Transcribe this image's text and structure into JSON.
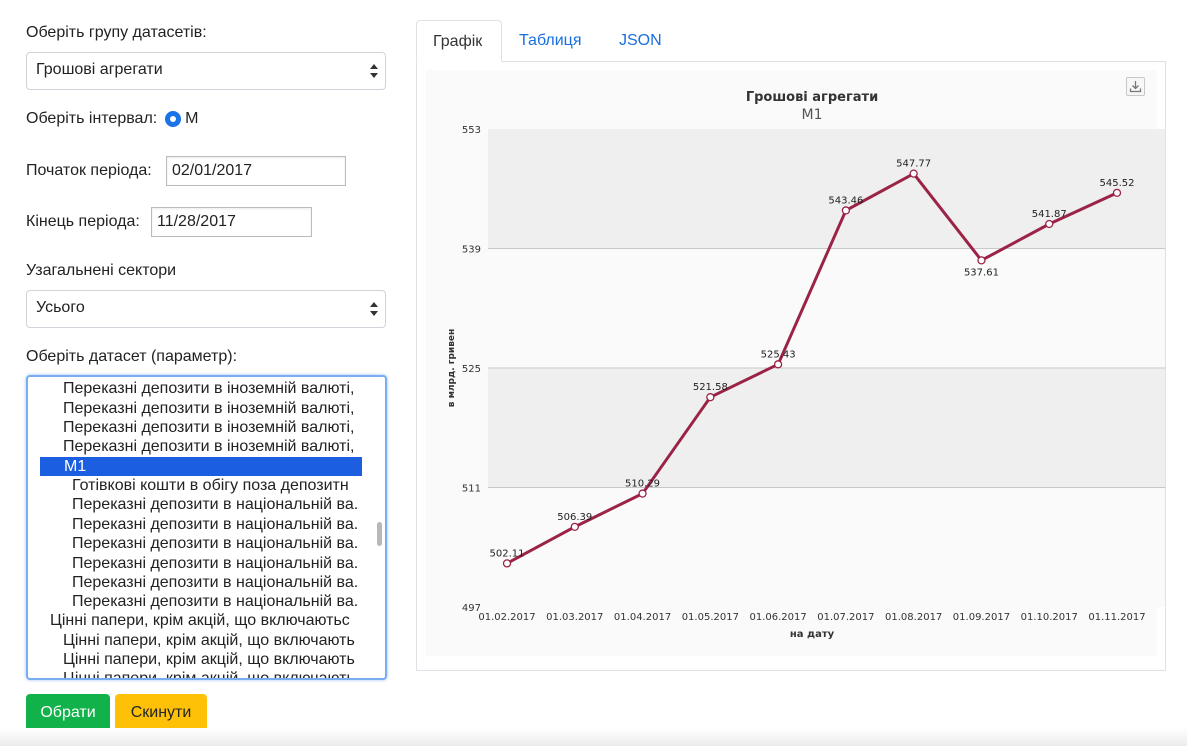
{
  "form": {
    "group_label": "Оберіть групу датасетів:",
    "group_value": "Грошові агрегати",
    "interval_label": "Оберіть інтервал:",
    "interval_option": "М",
    "start_label": "Початок періода:",
    "start_value": "02/01/2017",
    "end_label": "Кінець періода:",
    "end_value": "11/28/2017",
    "sectors_label": "Узагальнені сектори",
    "sectors_value": "Усього",
    "dataset_label": "Оберіть датасет (параметр):",
    "dataset_options": [
      "Переказні депозити в іноземній валюті,",
      "Переказні депозити в іноземній валюті,",
      "Переказні депозити в іноземній валюті,",
      "Переказні депозити в іноземній валюті,",
      "М1",
      "Готівкові кошти в обігу поза депозитн",
      "Переказні депозити в національній ва.",
      "Переказні депозити в національній ва.",
      "Переказні депозити в національній ва.",
      "Переказні депозити в національній ва.",
      "Переказні депозити в національній ва.",
      "Переказні депозити в національній ва.",
      "Цінні папери, крім акцій, що включаютьс",
      "Цінні папери, крім акцій, що включають",
      "Цінні папери, крім акцій, що включають",
      "Цінні папери, крім акцій, що включають"
    ],
    "selected_index": 4,
    "submit_label": "Обрати",
    "reset_label": "Скинути"
  },
  "tabs": [
    "Графік",
    "Таблиця",
    "JSON"
  ],
  "active_tab": 0,
  "colors": {
    "line": "#9b2346",
    "selected": "#1b5fe0",
    "tab_link": "#1a6fe0",
    "submit": "#12b24b",
    "reset": "#ffc107"
  },
  "icons": {
    "export": "download-icon",
    "select_arrow": "updown-arrows-icon"
  },
  "chart_data": {
    "type": "line",
    "title": "Грошові агрегати",
    "subtitle": "М1",
    "xlabel": "на дату",
    "ylabel": "в млрд. гривен",
    "categories": [
      "01.02.2017",
      "01.03.2017",
      "01.04.2017",
      "01.05.2017",
      "01.06.2017",
      "01.07.2017",
      "01.08.2017",
      "01.09.2017",
      "01.10.2017",
      "01.11.2017"
    ],
    "series": [
      {
        "values": [
          502.11,
          506.39,
          510.29,
          521.58,
          525.43,
          543.46,
          547.77,
          537.61,
          541.87,
          545.52
        ],
        "labels": [
          "502.11",
          "506.39",
          "510.29",
          "521.58",
          "525.43",
          "543.46",
          "547.77",
          "537.61",
          "541.87",
          "545.52"
        ]
      }
    ],
    "ylim": [
      497,
      553
    ],
    "yticks": [
      497,
      511,
      525,
      539,
      553
    ],
    "grid": true,
    "legend": "none"
  }
}
